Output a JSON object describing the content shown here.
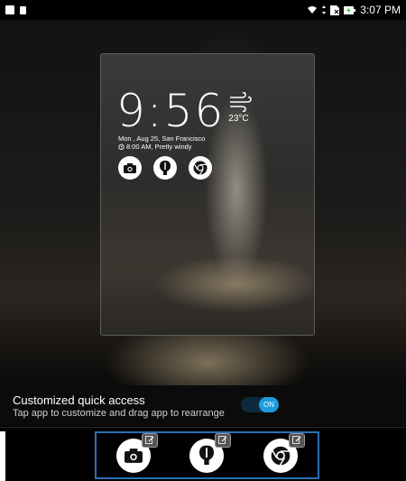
{
  "status_bar": {
    "left_icons": [
      "notification-icon",
      "sd-card-icon"
    ],
    "right_icons": [
      "wifi-icon",
      "signal-arrows-icon",
      "no-sim-icon",
      "battery-charging-icon"
    ],
    "time": "3:07 PM"
  },
  "preview": {
    "time": "9:56",
    "temperature": "23°C",
    "weather_icon": "windy-icon",
    "date_location": "Mon , Aug 25, San Francisco",
    "alarm_text": "8:00 AM, Pretty windy",
    "apps": [
      "camera-icon",
      "flashlight-icon",
      "chrome-icon"
    ]
  },
  "setting": {
    "title": "Customized quick access",
    "subtitle": "Tap app to customize and drag app to rearrange",
    "toggle_label": "ON",
    "toggle_on": true
  },
  "dock": {
    "apps": [
      "camera-icon",
      "flashlight-icon",
      "chrome-icon"
    ],
    "accent": "#2d6fb6"
  },
  "colors": {
    "toggle_accent": "#1e9ce0",
    "border_highlight": "#2d6fb6"
  }
}
